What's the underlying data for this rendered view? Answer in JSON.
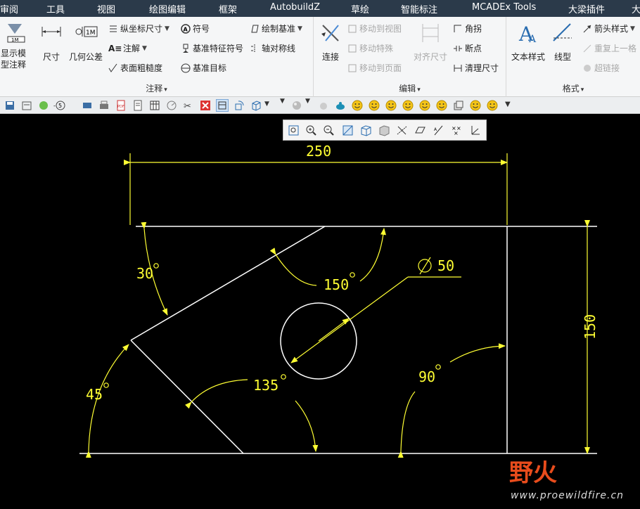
{
  "menubar": {
    "items": [
      "审阅",
      "工具",
      "视图",
      "绘图编辑",
      "框架",
      "AutobuildZ",
      "草绘",
      "智能标注",
      "MCADEx Tools",
      "大梁插件",
      "大"
    ]
  },
  "ribbon": {
    "annotate_group": {
      "title": "注释",
      "show_model_annotation": "显示模型注释",
      "dimension": "尺寸",
      "geo_tolerance": "几何公差",
      "ordinate_dim": "纵坐标尺寸",
      "note": "注解",
      "surface_finish": "表面粗糙度",
      "symbol": "符号",
      "datum_feature_symbol": "基准特征符号",
      "datum_target": "基准目标",
      "draw_datum": "绘制基准",
      "axis_symmetric": "轴对称线"
    },
    "edit_group": {
      "title": "编辑",
      "connect": "连接",
      "move_to_view": "移动到视图",
      "move_special": "移动特殊",
      "move_to_page": "移动到页面",
      "align_dim": "对齐尺寸",
      "corner": "角拐",
      "breakpoint": "断点",
      "clean_dim": "清理尺寸"
    },
    "format_group": {
      "title": "格式",
      "text_style": "文本样式",
      "line_style": "线型",
      "arrow_style": "箭头样式",
      "repeat_last": "重复上一格",
      "hyperlink": "超链接"
    }
  },
  "drawing": {
    "dim_width": "250",
    "dim_height": "150",
    "dim_diameter": "50",
    "angle_30": "30",
    "angle_150": "150",
    "angle_45": "45",
    "angle_135": "135",
    "angle_90": "90",
    "line_color": "#ffffff",
    "dim_color": "#ffff33"
  },
  "watermark": {
    "logo": "野火",
    "url": "www.proewildfire.cn"
  }
}
